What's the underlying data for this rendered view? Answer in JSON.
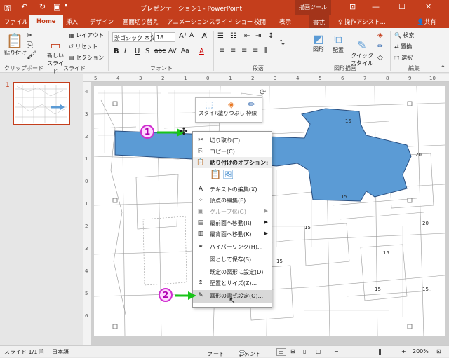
{
  "titlebar": {
    "title": "プレゼンテーション1 - PowerPoint",
    "context_tab_group": "描画ツール"
  },
  "tabs": [
    "ファイル",
    "Home",
    "挿入",
    "デザイン",
    "画面切り替え",
    "アニメーション",
    "スライド ショー",
    "校閲",
    "表示",
    "書式"
  ],
  "tell_me": "操作アシスト...",
  "share": "共有",
  "ribbon": {
    "clipboard": {
      "paste": "貼り付け",
      "label": "クリップボード"
    },
    "slides": {
      "new_slide": "新しい\nスライド",
      "layout": "レイアウト",
      "reset": "リセット",
      "section": "セクション",
      "label": "スライド"
    },
    "font": {
      "name": "游ゴシック 本文",
      "size": "18",
      "label": "フォント"
    },
    "paragraph": {
      "label": "段落"
    },
    "drawing": {
      "shapes": "図形",
      "arrange": "配置",
      "quick_styles": "クイック\nスタイル",
      "label": "図形描画"
    },
    "editing": {
      "find": "検索",
      "replace": "置換",
      "select": "選択",
      "label": "編集"
    }
  },
  "thumb": {
    "number": "1"
  },
  "mini_toolbar": {
    "style": "スタイル",
    "fill": "塗りつぶし",
    "outline": "枠線"
  },
  "context_menu": [
    {
      "icon": "✂",
      "label": "切り取り(T)",
      "state": "normal"
    },
    {
      "icon": "⎘",
      "label": "コピー(C)",
      "state": "normal"
    },
    {
      "icon": "📋",
      "label": "貼り付けのオプション:",
      "state": "header"
    },
    {
      "icon": "",
      "label": "",
      "state": "paste-icons"
    },
    {
      "icon": "A",
      "label": "テキストの編集(X)",
      "state": "normal"
    },
    {
      "icon": "⁘",
      "label": "頂点の編集(E)",
      "state": "normal"
    },
    {
      "icon": "▣",
      "label": "グループ化(G)",
      "state": "disabled",
      "submenu": true
    },
    {
      "icon": "▤",
      "label": "最前面へ移動(R)",
      "state": "normal",
      "submenu": true
    },
    {
      "icon": "▥",
      "label": "最背面へ移動(K)",
      "state": "normal",
      "submenu": true
    },
    {
      "icon": "⚭",
      "label": "ハイパーリンク(H)...",
      "state": "normal"
    },
    {
      "icon": "",
      "label": "図として保存(S)...",
      "state": "normal"
    },
    {
      "icon": "",
      "label": "既定の図形に設定(D)",
      "state": "normal"
    },
    {
      "icon": "↕",
      "label": "配置とサイズ(Z)...",
      "state": "normal"
    },
    {
      "icon": "✎",
      "label": "図形の書式設定(O)...",
      "state": "highlight"
    }
  ],
  "annotations": {
    "step1": "1",
    "step2": "2"
  },
  "map_labels": [
    "15",
    "20",
    "15",
    "20",
    "15",
    "15",
    "15",
    "15",
    "15"
  ],
  "statusbar": {
    "slide": "スライド 1/1",
    "language": "日本語",
    "notes": "ノート",
    "comments": "コメント",
    "zoom": "200%"
  },
  "colors": {
    "accent": "#c43e1c",
    "shape_fill": "#5b9bd5",
    "annotation": "#d02ed0",
    "arrow": "#19c419"
  }
}
